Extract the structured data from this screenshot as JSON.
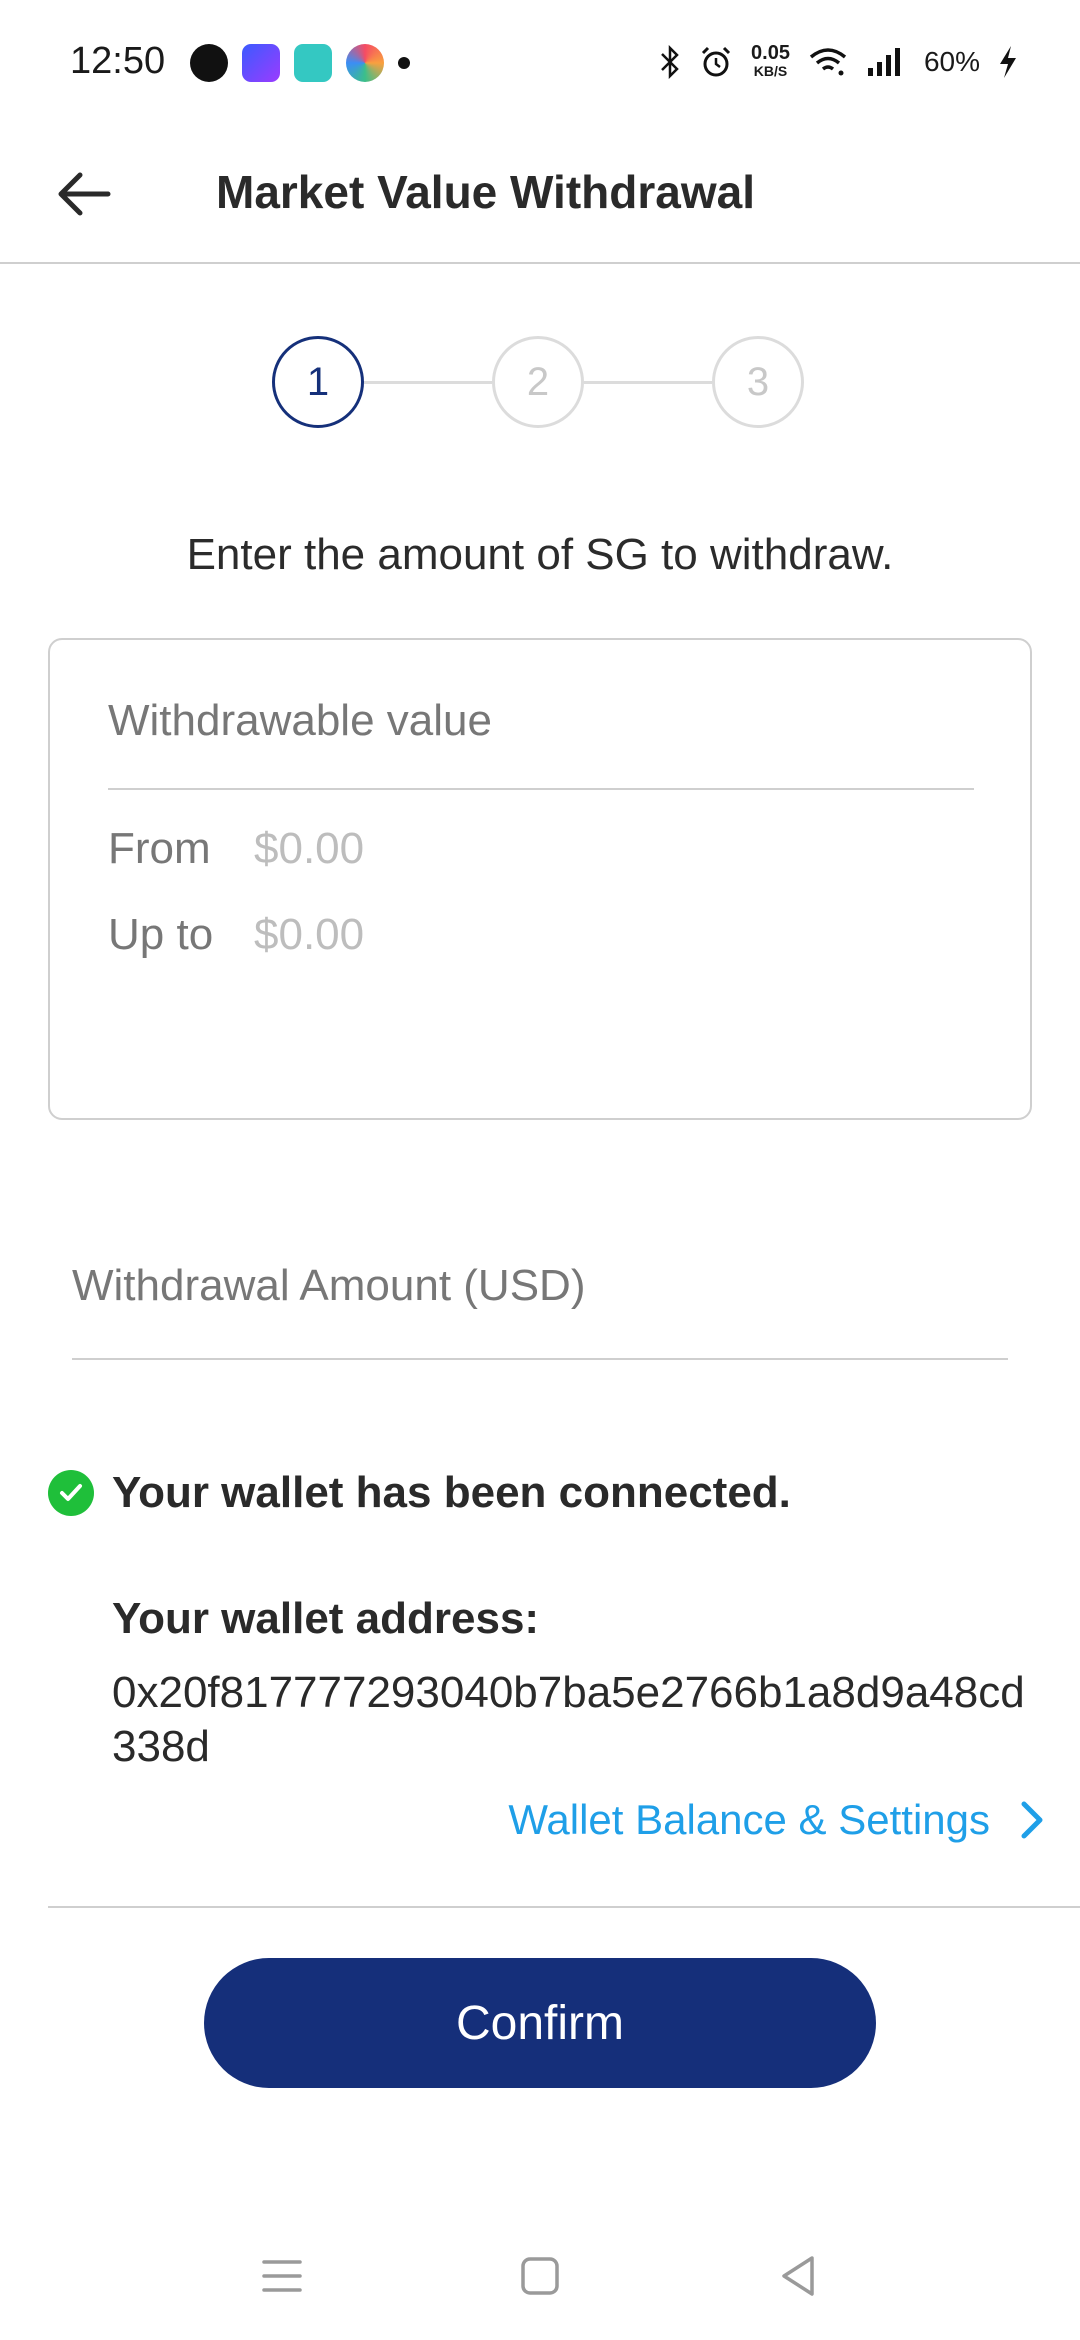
{
  "status_bar": {
    "time": "12:50",
    "net_speed_value": "0.05",
    "net_speed_unit": "KB/S",
    "battery": "60%",
    "notification_icons": [
      "messenger-icon",
      "calendar-app-icon",
      "teal-app-icon",
      "colorful-app-icon"
    ],
    "system_icons": [
      "bluetooth-icon",
      "alarm-icon",
      "wifi-icon",
      "signal-icon",
      "charging-icon"
    ]
  },
  "header": {
    "title": "Market Value Withdrawal",
    "back_icon": "arrow-left-icon"
  },
  "stepper": {
    "steps": [
      "1",
      "2",
      "3"
    ],
    "active_step": 1
  },
  "instruction": "Enter the amount of SG to withdraw.",
  "withdrawable": {
    "title": "Withdrawable value",
    "from_label": "From",
    "from_value": "$0.00",
    "upto_label": "Up to",
    "upto_value": "$0.00"
  },
  "amount_input": {
    "placeholder": "Withdrawal Amount (USD)",
    "value": ""
  },
  "wallet": {
    "status_text": "Your wallet has been connected.",
    "address_label": "Your wallet address:",
    "address": "0x20f817777293040b7ba5e2766b1a8d9a48cd338d",
    "settings_link": "Wallet Balance & Settings"
  },
  "confirm_label": "Confirm",
  "colors": {
    "primary": "#152f7a",
    "link": "#1f9fe8",
    "success": "#1fbf3a"
  }
}
